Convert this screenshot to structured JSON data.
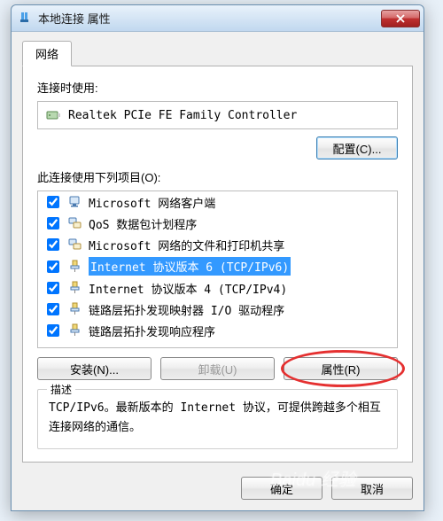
{
  "window": {
    "title": "本地连接 属性"
  },
  "tab": {
    "network": "网络"
  },
  "adapter": {
    "label": "连接时使用:",
    "name": "Realtek PCIe FE Family Controller",
    "configure_btn": "配置(C)..."
  },
  "items_label": "此连接使用下列项目(O):",
  "items": [
    {
      "checked": true,
      "icon": "client",
      "label": "Microsoft 网络客户端"
    },
    {
      "checked": true,
      "icon": "service",
      "label": "QoS 数据包计划程序"
    },
    {
      "checked": true,
      "icon": "service",
      "label": "Microsoft 网络的文件和打印机共享"
    },
    {
      "checked": true,
      "icon": "protocol",
      "label": "Internet 协议版本 6 (TCP/IPv6)",
      "selected": true
    },
    {
      "checked": true,
      "icon": "protocol",
      "label": "Internet 协议版本 4 (TCP/IPv4)"
    },
    {
      "checked": true,
      "icon": "protocol",
      "label": "链路层拓扑发现映射器 I/O 驱动程序"
    },
    {
      "checked": true,
      "icon": "protocol",
      "label": "链路层拓扑发现响应程序"
    }
  ],
  "buttons": {
    "install": "安装(N)...",
    "uninstall": "卸载(U)",
    "properties": "属性(R)",
    "ok": "确定",
    "cancel": "取消"
  },
  "description": {
    "title": "描述",
    "text": "TCP/IPv6。最新版本的 Internet 协议，可提供跨越多个相互连接网络的通信。"
  },
  "highlight": {
    "target": "properties-button",
    "color": "#e53030"
  },
  "watermark": "Baidu 经验"
}
